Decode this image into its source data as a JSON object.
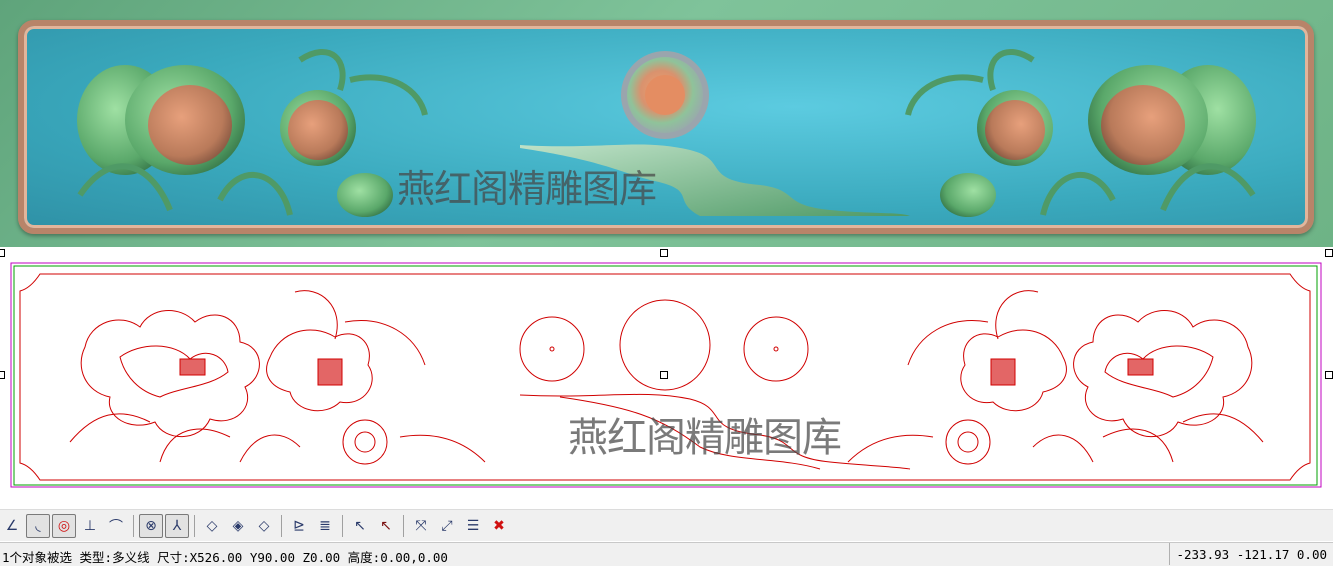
{
  "preview": {
    "watermark": "燕红阁精雕图库",
    "colors": {
      "background": "#6fb48a",
      "panel": "#42b6cb",
      "frame": "#b88469",
      "relief_flower": "#c78566",
      "relief_leaf": "#5aa86a"
    }
  },
  "vector": {
    "watermark": "燕红阁精雕图库",
    "colors": {
      "outline": "#d00000",
      "bounds_green": "#00a000",
      "bounds_magenta": "#c000c0"
    }
  },
  "toolbar": {
    "icons": [
      "angle-icon",
      "arc-fillet-icon",
      "circle-target-icon",
      "perpendicular-icon",
      "curve-snap-icon",
      "node-snap-icon",
      "vector-snap-icon",
      "diamond-outline-icon",
      "diamond-cross-icon",
      "diamond-dot-icon",
      "align-left-icon",
      "align-stack-icon",
      "select-cursor-icon",
      "deselect-cursor-icon",
      "transform-icon",
      "node-edit-icon",
      "list-edit-icon",
      "delete-icon"
    ]
  },
  "status": {
    "selection_text": "1个对象被选 类型:多义线 尺寸:X526.00 Y90.00 Z0.00 高度:0.00,0.00",
    "coordinates": "-233.93 -121.17 0.00"
  }
}
